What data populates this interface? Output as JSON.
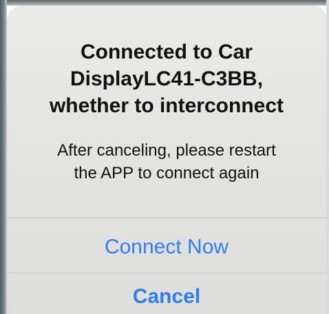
{
  "dialog": {
    "title_lines": [
      "Connected to Car",
      "DisplayLC41-C3BB,",
      "whether to interconnect"
    ],
    "message_lines": [
      "After canceling, please restart",
      "the APP to connect again"
    ],
    "buttons": {
      "connect_label": "Connect Now",
      "cancel_label": "Cancel"
    }
  },
  "colors": {
    "accent": "#2e7cf6",
    "dialog_background": "#e6e6e4",
    "text": "#111111"
  }
}
